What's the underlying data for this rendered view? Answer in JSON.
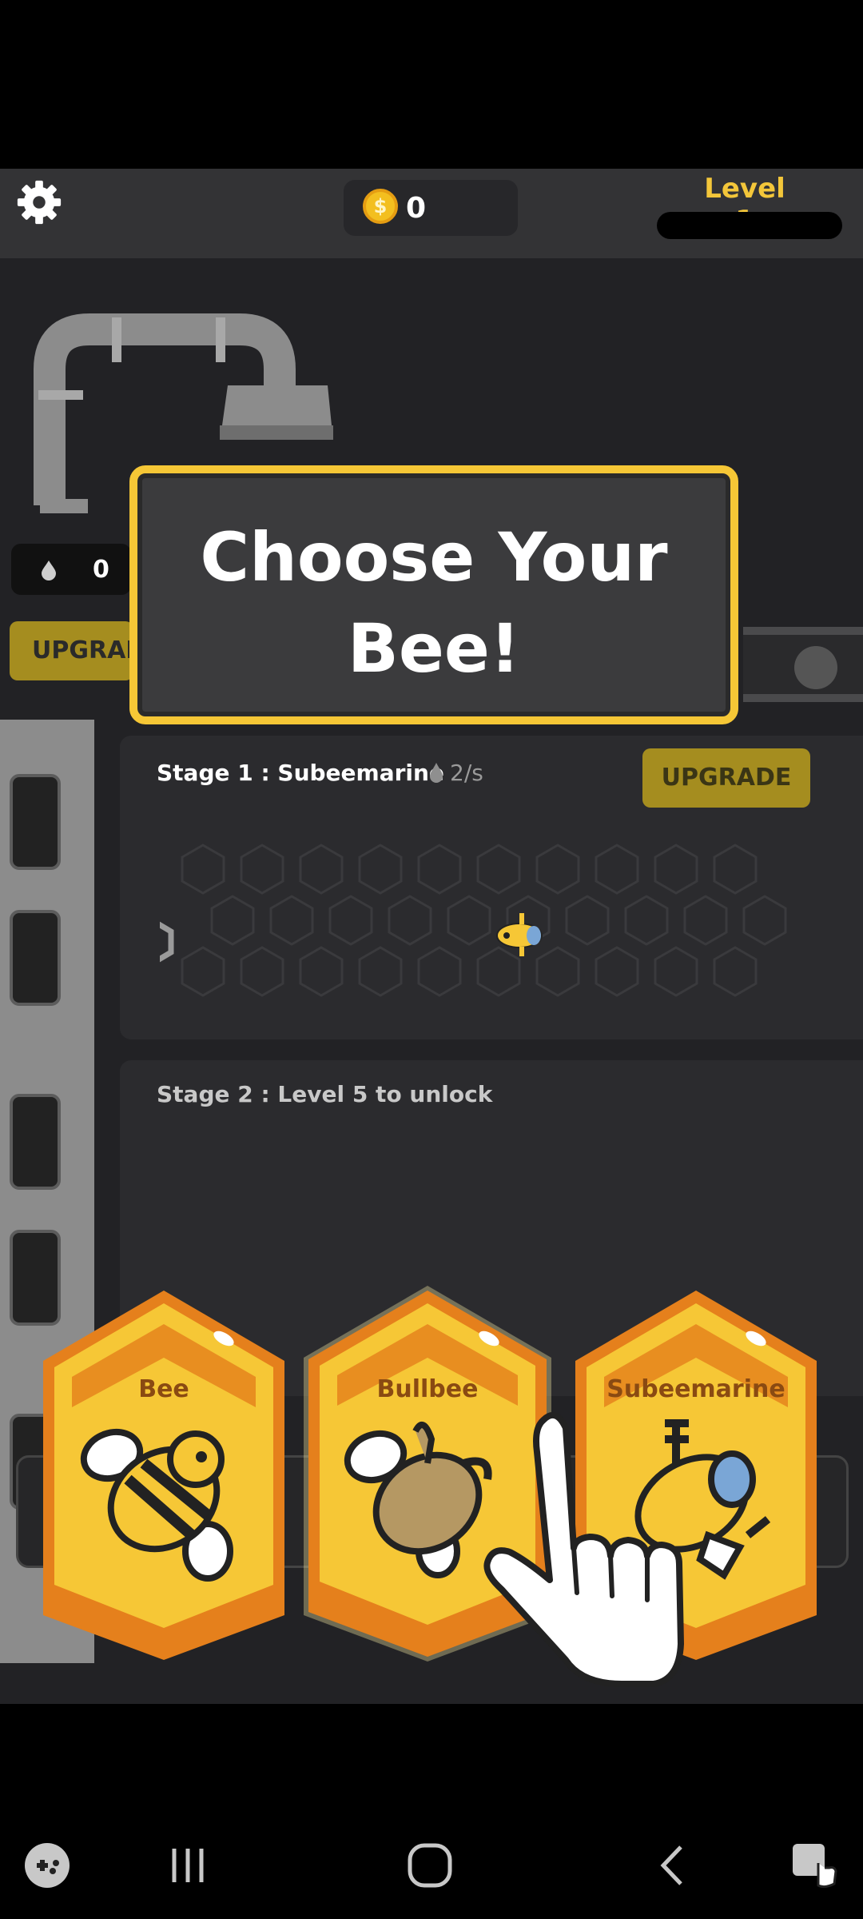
{
  "hud": {
    "coins": "0",
    "level_label": "Level 1",
    "level_progress": 0
  },
  "resource": {
    "amount": "0",
    "upgrade_label": "UPGRAD"
  },
  "dialog": {
    "line1": "Choose Your",
    "line2": "Bee!"
  },
  "stages": [
    {
      "title": "Stage 1 : Subeemarine",
      "rate": "2/s",
      "upgrade_label": "UPGRADE"
    },
    {
      "title": "Stage 2 : Level 5 to unlock"
    }
  ],
  "bee_choices": [
    {
      "name": "Bee",
      "icon": "bee-icon"
    },
    {
      "name": "Bullbee",
      "icon": "bullbee-icon"
    },
    {
      "name": "Subeemarine",
      "icon": "subeemarine-icon"
    }
  ],
  "colors": {
    "accent_gold": "#f6c736",
    "card_orange": "#e5801c",
    "background": "#222225"
  },
  "navbar": {
    "icons": [
      "game-launcher-icon",
      "recent-apps-icon",
      "home-icon",
      "back-icon",
      "accessibility-icon"
    ]
  }
}
